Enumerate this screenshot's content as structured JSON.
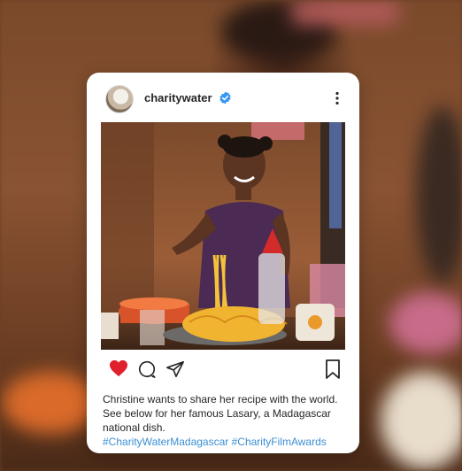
{
  "post": {
    "username": "charitywater",
    "caption": "Christine wants to share her recipe with the world. See below for her famous Lasary, a Madagascar national dish.",
    "hashtags": "#CharityWaterMadagascar #CharityFilmAwards"
  },
  "icons": {
    "avatar": "profile-avatar",
    "verified": "verified-badge-icon",
    "more": "more-options-icon",
    "like": "heart-icon",
    "comment": "comment-icon",
    "share": "share-icon",
    "save": "bookmark-icon"
  },
  "colors": {
    "like": "#e0202d",
    "verified": "#3897f0",
    "hashtag": "#3b8fd4"
  }
}
